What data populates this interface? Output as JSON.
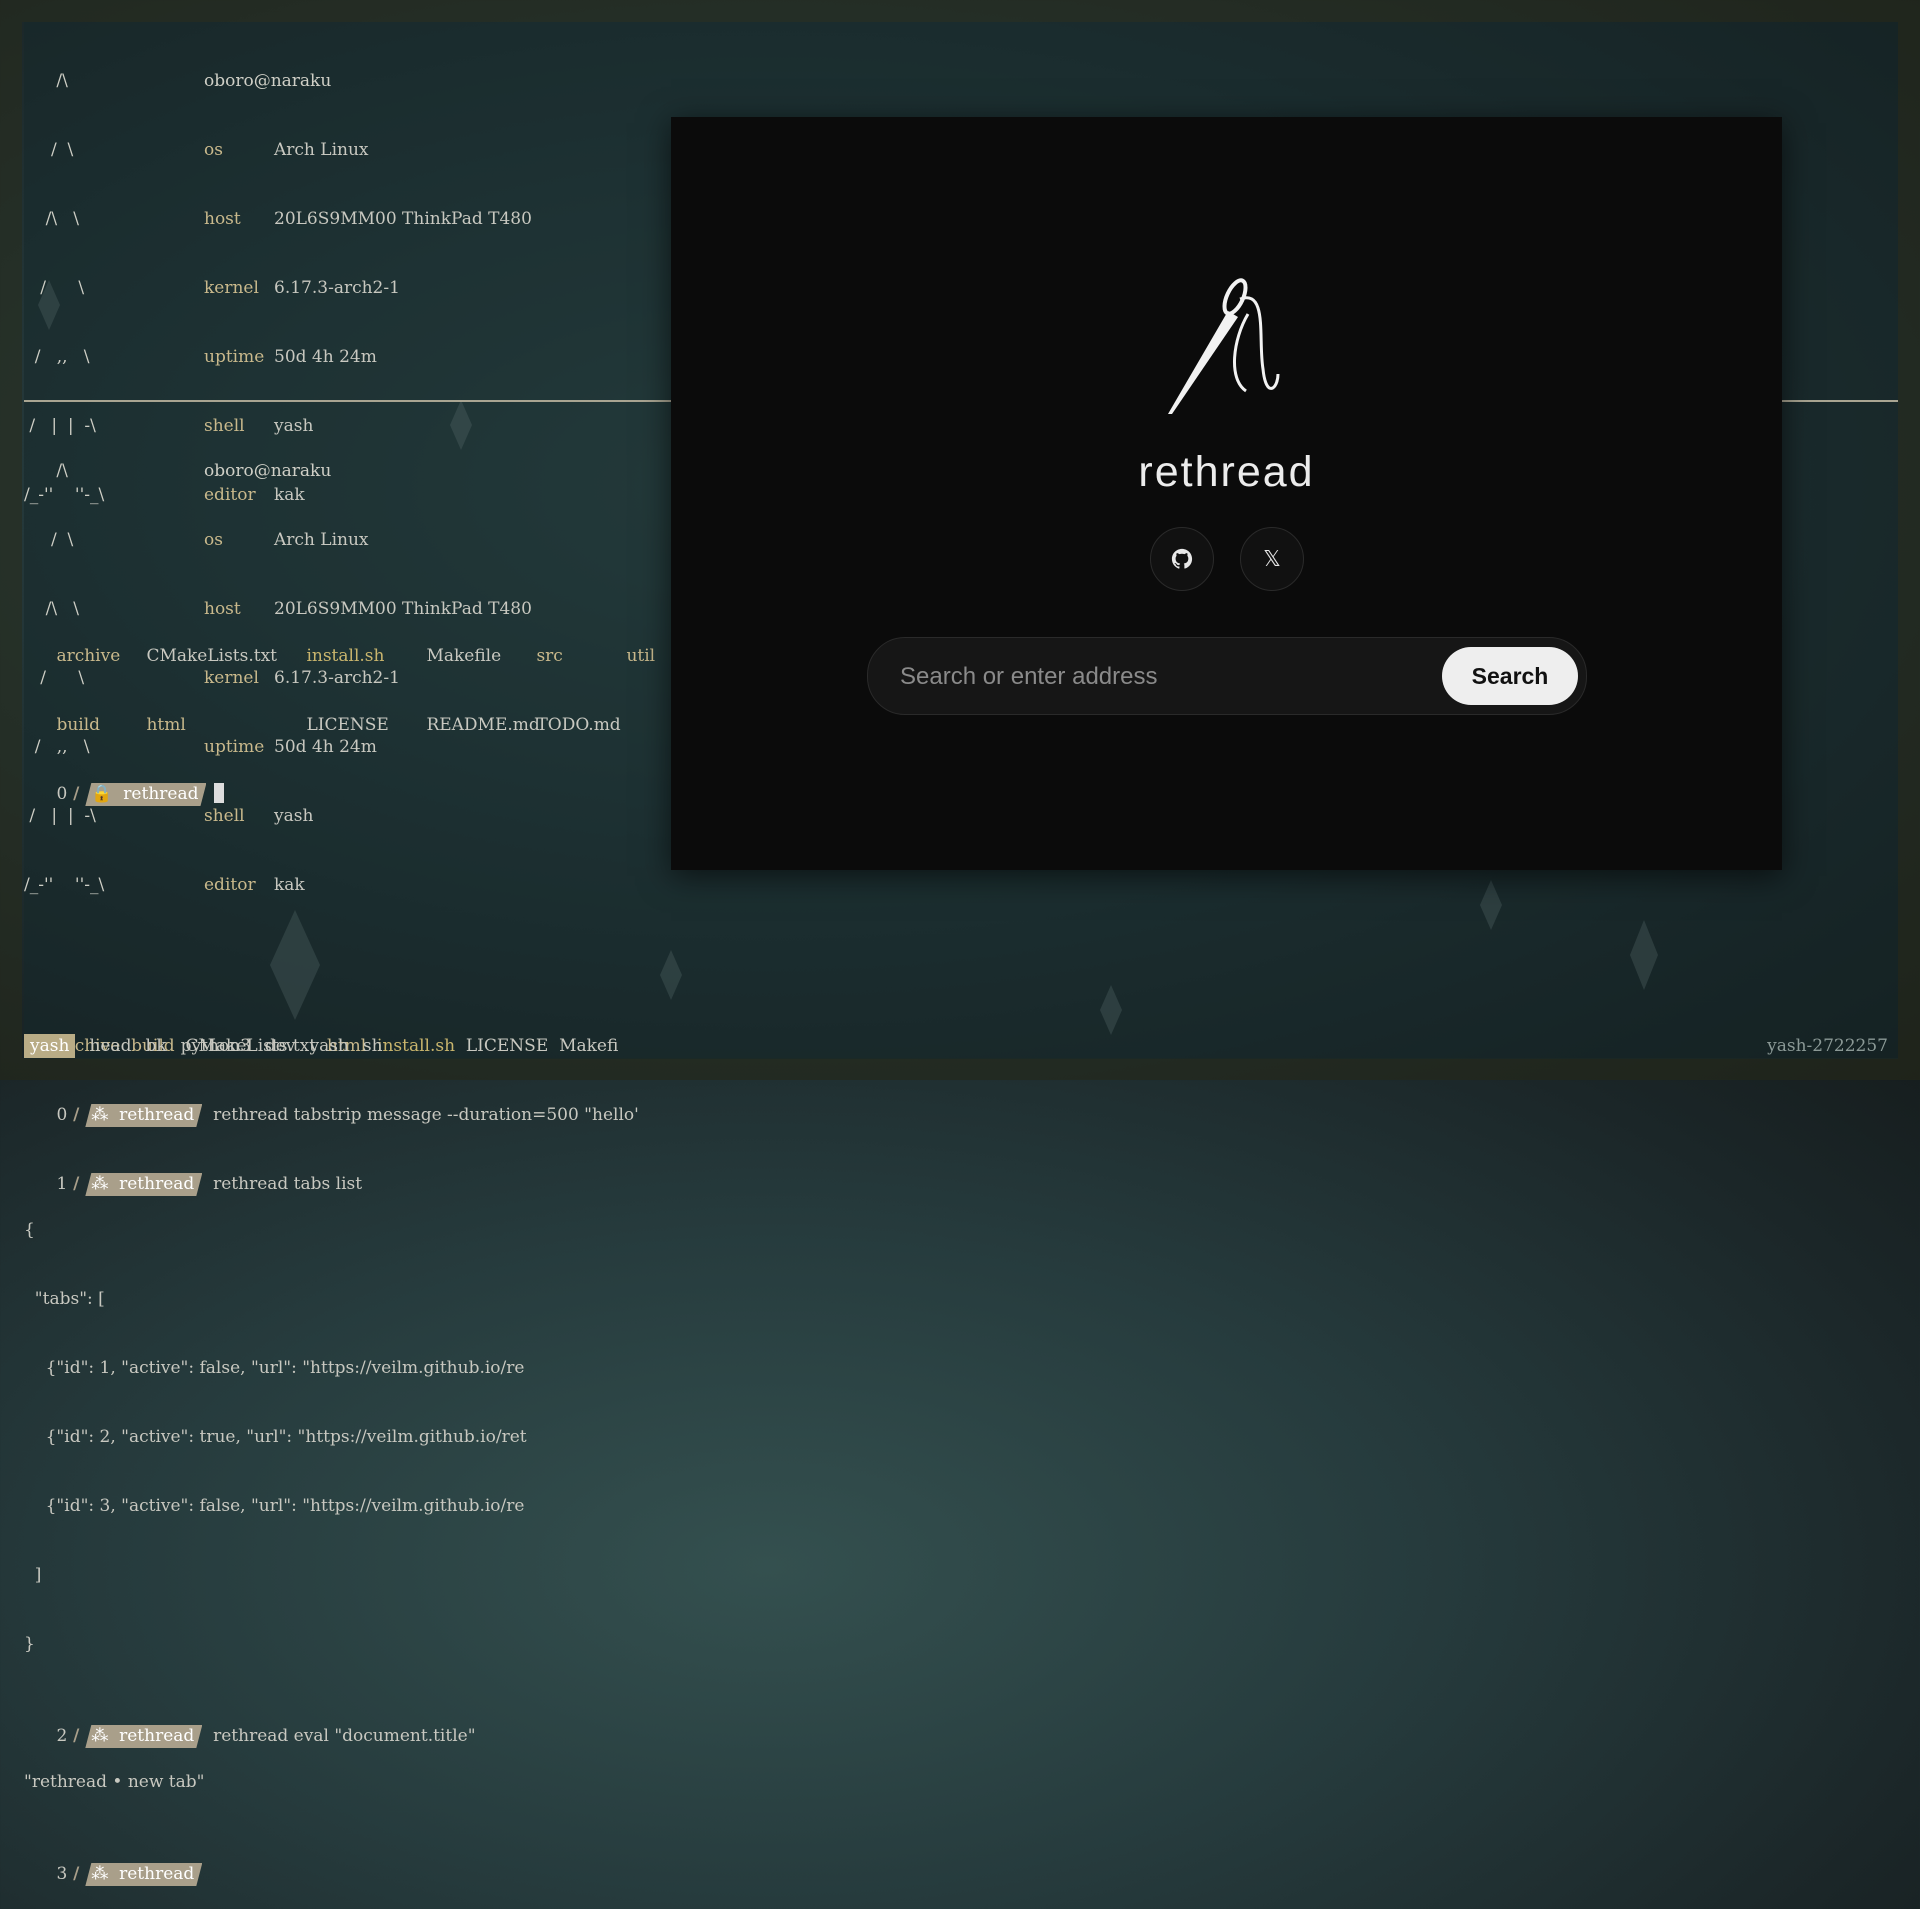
{
  "fetch": {
    "user": "oboro@naraku",
    "logo_lines": [
      "      /\\",
      "     /  \\",
      "    /\\   \\",
      "   /      \\",
      "  /   ,,   \\",
      " /   |  |  -\\",
      "/_-''    ''-_\\"
    ],
    "rows": [
      {
        "key": "os",
        "value": "Arch Linux"
      },
      {
        "key": "host",
        "value": "20L6S9MM00 ThinkPad T480"
      },
      {
        "key": "kernel",
        "value": "6.17.3-arch2-1"
      },
      {
        "key": "uptime",
        "value": "50d 4h 24m"
      },
      {
        "key": "shell",
        "value": "yash"
      },
      {
        "key": "editor",
        "value": "kak"
      }
    ]
  },
  "top_pane": {
    "ls_row1": [
      "archive",
      "CMakeLists.txt",
      "install.sh",
      "Makefile",
      "src",
      "util"
    ],
    "ls_row2": [
      "build",
      "html",
      "",
      "LICENSE",
      "README.md",
      "TODO.md"
    ],
    "prompt_num": "0",
    "prompt_label": "rethread"
  },
  "bottom_pane": {
    "ls": [
      "archive",
      "build",
      "CMakeLists.txt",
      "html",
      "install.sh",
      "LICENSE",
      "Makefi"
    ],
    "cmd0_num": "0",
    "cmd0": "rethread tabstrip message --duration=500 \"hello'",
    "cmd1_num": "1",
    "cmd1": "rethread tabs list",
    "json_lines": [
      "{",
      "  \"tabs\": [",
      "    {\"id\": 1, \"active\": false, \"url\": \"https://veilm.github.io/re",
      "    {\"id\": 2, \"active\": true, \"url\": \"https://veilm.github.io/ret",
      "    {\"id\": 3, \"active\": false, \"url\": \"https://veilm.github.io/re",
      "  ]",
      "}"
    ],
    "cmd2_num": "2",
    "cmd2": "rethread eval \"document.title\"",
    "cmd2_out": "\"rethread • new tab\"",
    "cmd3_num": "3",
    "prompt_label": "rethread"
  },
  "statusbar": {
    "tabs": [
      "yash",
      "head",
      "bk",
      "python3",
      "dev",
      "yash",
      "sh"
    ],
    "right": "yash-2722257"
  },
  "browser": {
    "brand": "rethread",
    "github_icon": "github-icon",
    "x_icon": "x-logo-icon",
    "x_glyph": "𝕏",
    "search_placeholder": "Search or enter address",
    "search_button": "Search"
  }
}
